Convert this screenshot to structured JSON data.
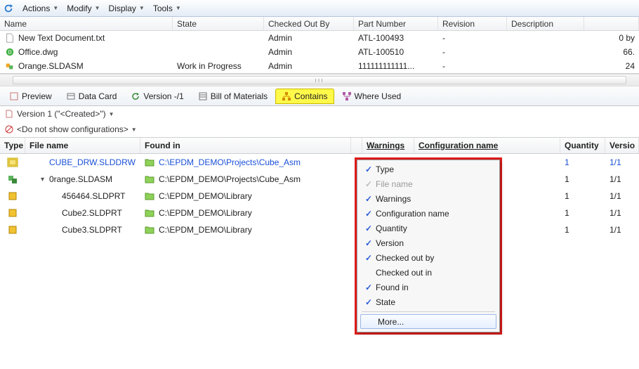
{
  "menu": {
    "items": [
      "Actions",
      "Modify",
      "Display",
      "Tools"
    ]
  },
  "upperGrid": {
    "headers": {
      "name": "Name",
      "state": "State",
      "checkedOutBy": "Checked Out By",
      "partNumber": "Part Number",
      "revision": "Revision",
      "description": "Description"
    },
    "rows": [
      {
        "icon": "file",
        "name": "New Text Document.txt",
        "state": "",
        "cob": "Admin",
        "part": "ATL-100493",
        "rev": "-",
        "tail": "0 by"
      },
      {
        "icon": "dwg",
        "name": "Office.dwg",
        "state": "",
        "cob": "Admin",
        "part": "ATL-100510",
        "rev": "-",
        "tail": "66."
      },
      {
        "icon": "asm",
        "name": "Orange.SLDASM",
        "state": "Work in Progress",
        "cob": "Admin",
        "part": "111111111111...",
        "rev": "-",
        "tail": "24"
      }
    ]
  },
  "tabs": {
    "preview": "Preview",
    "dataCard": "Data Card",
    "version": "Version -/1",
    "bom": "Bill of Materials",
    "contains": "Contains",
    "whereUsed": "Where Used"
  },
  "versionBar": "Version 1 (\"<Created>\")",
  "configBar": "<Do not show configurations>",
  "lowerGrid": {
    "headers": {
      "type": "Type",
      "file": "File name",
      "found": "Found in",
      "warnings": "Warnings",
      "config": "Configuration name",
      "qty": "Quantity",
      "version": "Versio"
    },
    "rows": [
      {
        "typeIcon": "drw",
        "indent": 1,
        "toggle": "",
        "file": "CUBE_DRW.SLDDRW",
        "found": "C:\\EPDM_DEMO\\Projects\\Cube_Asm",
        "qty": "1",
        "ver": "1/1",
        "link": true
      },
      {
        "typeIcon": "asm",
        "indent": 1,
        "toggle": "▾",
        "file": "0range.SLDASM",
        "found": "C:\\EPDM_DEMO\\Projects\\Cube_Asm",
        "qty": "1",
        "ver": "1/1",
        "link": false
      },
      {
        "typeIcon": "prt",
        "indent": 2,
        "toggle": "",
        "file": "456464.SLDPRT",
        "found": "C:\\EPDM_DEMO\\Library",
        "qty": "1",
        "ver": "1/1",
        "link": false
      },
      {
        "typeIcon": "prt",
        "indent": 2,
        "toggle": "",
        "file": "Cube2.SLDPRT",
        "found": "C:\\EPDM_DEMO\\Library",
        "qty": "1",
        "ver": "1/1",
        "link": false
      },
      {
        "typeIcon": "prt",
        "indent": 2,
        "toggle": "",
        "file": "Cube3.SLDPRT",
        "found": "C:\\EPDM_DEMO\\Library",
        "qty": "1",
        "ver": "1/1",
        "link": false
      }
    ]
  },
  "contextMenu": {
    "items": [
      {
        "label": "Type",
        "checked": true,
        "disabled": false
      },
      {
        "label": "File name",
        "checked": true,
        "disabled": true
      },
      {
        "label": "Warnings",
        "checked": true,
        "disabled": false
      },
      {
        "label": "Configuration name",
        "checked": true,
        "disabled": false
      },
      {
        "label": "Quantity",
        "checked": true,
        "disabled": false
      },
      {
        "label": "Version",
        "checked": true,
        "disabled": false
      },
      {
        "label": "Checked out by",
        "checked": true,
        "disabled": false
      },
      {
        "label": "Checked out in",
        "checked": false,
        "disabled": false
      },
      {
        "label": "Found in",
        "checked": true,
        "disabled": false
      },
      {
        "label": "State",
        "checked": true,
        "disabled": false
      }
    ],
    "more": "More..."
  }
}
